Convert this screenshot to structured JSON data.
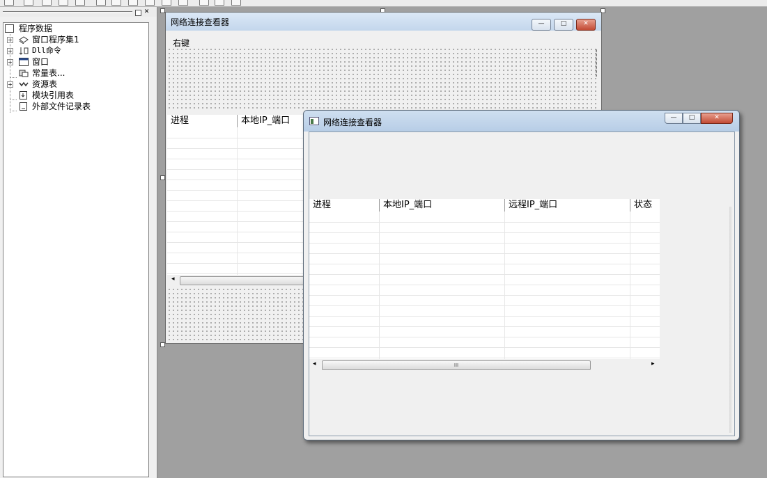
{
  "tree": {
    "root_label": "程序数据",
    "items": [
      {
        "label": "窗口程序集1",
        "icon": "layers-icon",
        "expandable": true
      },
      {
        "label": "Dll命令",
        "icon": "dll-command-icon",
        "expandable": true
      },
      {
        "label": "窗口",
        "icon": "window-icon",
        "expandable": true
      },
      {
        "label": "常量表...",
        "icon": "constants-icon",
        "expandable": false
      },
      {
        "label": "资源表",
        "icon": "resources-icon",
        "expandable": true
      },
      {
        "label": "模块引用表",
        "icon": "module-reference-icon",
        "expandable": false
      },
      {
        "label": "外部文件记录表",
        "icon": "external-file-icon",
        "expandable": false
      }
    ]
  },
  "designer": {
    "title": "网络连接查看器",
    "label_text": "右键",
    "columns": [
      "进程",
      "本地IP_端口"
    ]
  },
  "preview": {
    "title": "网络连接查看器",
    "columns": [
      "进程",
      "本地IP_端口",
      "远程IP_端口",
      "状态"
    ],
    "scroll_thumb_glyph": "III",
    "scroll_left_glyph": "◂",
    "scroll_right_glyph": "▸"
  },
  "window_controls": {
    "minimize": "—",
    "maximize": "□",
    "close": "✕"
  },
  "colors": {
    "desktop": "#a0a0a0",
    "titlebar": "#c3d6ec",
    "close": "#c24a34"
  }
}
